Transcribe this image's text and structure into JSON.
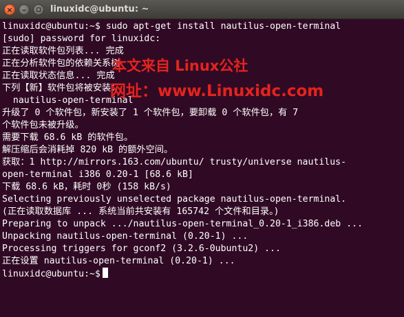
{
  "window": {
    "title": "linuxidc@ubuntu: ~",
    "close_glyph": "×",
    "minimize_glyph": "–"
  },
  "terminal": {
    "lines": [
      "linuxidc@ubuntu:~$ sudo apt-get install nautilus-open-terminal",
      "[sudo] password for linuxidc:",
      "正在读取软件包列表... 完成",
      "正在分析软件包的依赖关系树",
      "正在读取状态信息... 完成",
      "下列【新】软件包将被安装：",
      "  nautilus-open-terminal",
      "升级了 0 个软件包，新安装了 1 个软件包，要卸载 0 个软件包，有 7",
      "个软件包未被升级。",
      "需要下载 68.6 kB 的软件包。",
      "解压缩后会消耗掉 820 kB 的额外空间。",
      "获取：1 http://mirrors.163.com/ubuntu/ trusty/universe nautilus-",
      "open-terminal i386 0.20-1 [68.6 kB]",
      "下载 68.6 kB，耗时 0秒 (158 kB/s)",
      "Selecting previously unselected package nautilus-open-terminal.",
      "(正在读取数据库 ... 系统当前共安装有 165742 个文件和目录。)",
      "Preparing to unpack .../nautilus-open-terminal_0.20-1_i386.deb ...",
      "Unpacking nautilus-open-terminal (0.20-1) ...",
      "Processing triggers for gconf2 (3.2.6-0ubuntu2) ...",
      "正在设置 nautilus-open-terminal (0.20-1) ...",
      "linuxidc@ubuntu:~$"
    ]
  },
  "watermark": {
    "line1": "本文来自 Linux公社",
    "line2": "网址：www.Linuxidc.com"
  },
  "colors": {
    "terminal_bg": "#300a24",
    "terminal_fg": "#ffffff",
    "watermark": "#e5231e",
    "close_button": "#e95420"
  },
  "icons": [
    "close-icon",
    "minimize-icon",
    "maximize-icon",
    "cursor-block"
  ]
}
